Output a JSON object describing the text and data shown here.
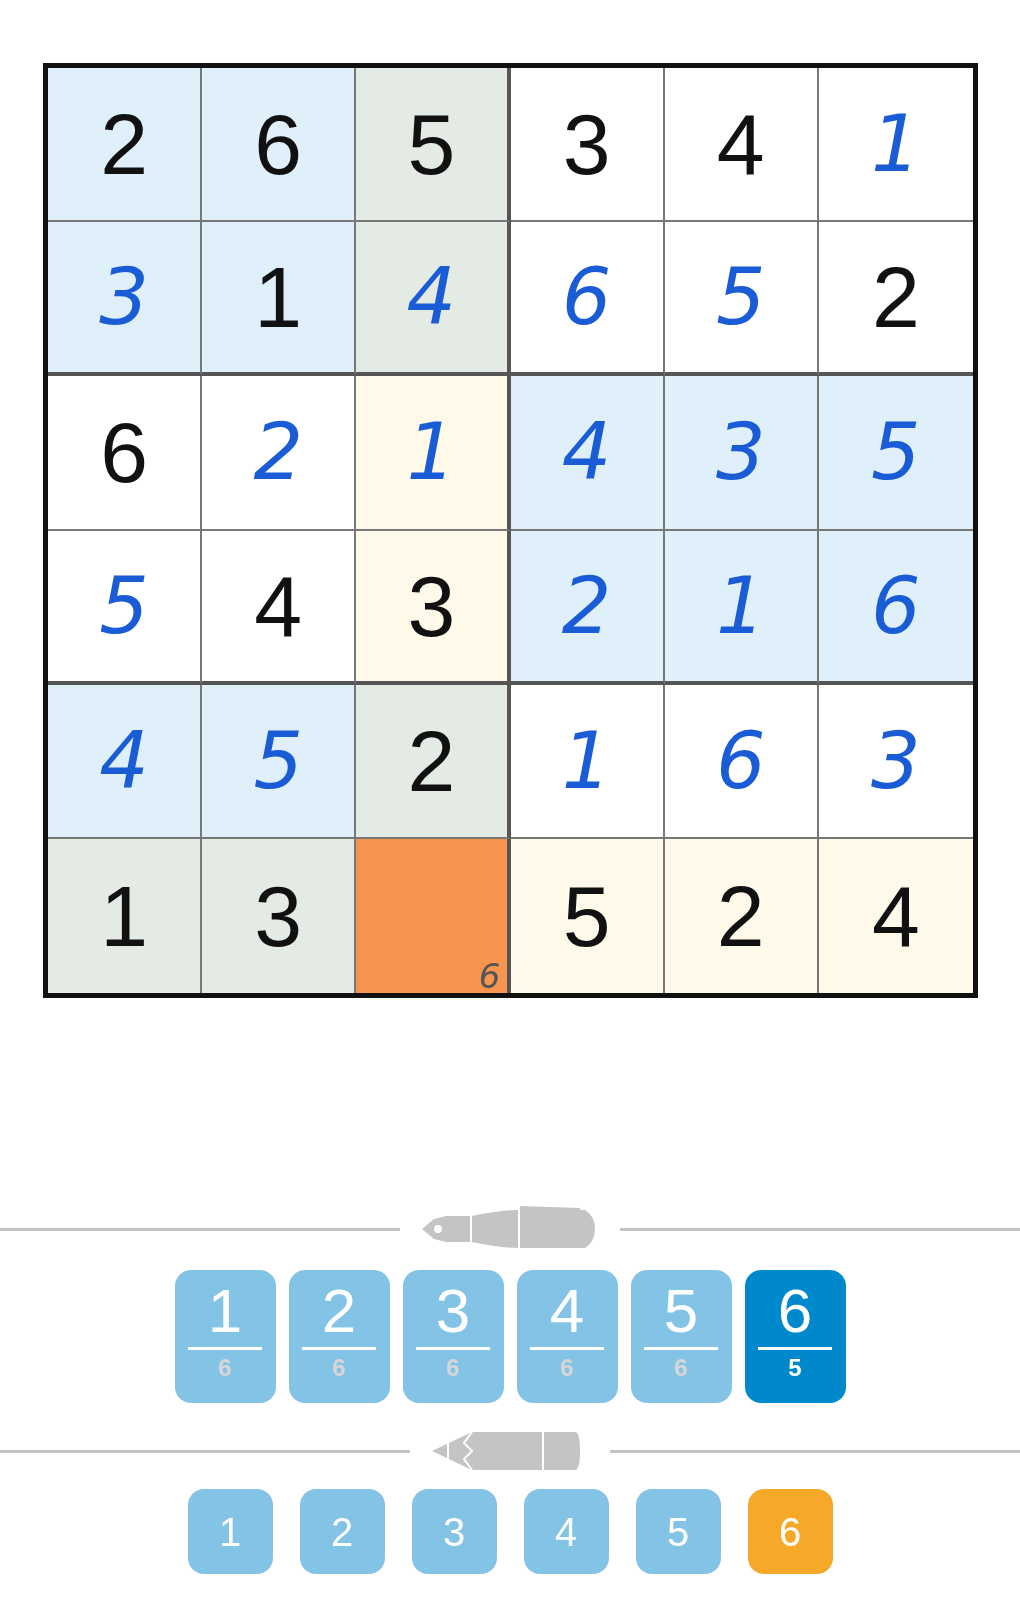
{
  "grid": {
    "rows": [
      [
        {
          "value": "2",
          "kind": "given",
          "color": "#dff0fb",
          "selected": false
        },
        {
          "value": "6",
          "kind": "given",
          "color": "#dff0fb",
          "selected": false
        },
        {
          "value": "5",
          "kind": "given",
          "color": "#e4eae4",
          "selected": false
        },
        {
          "value": "3",
          "kind": "given",
          "color": "#ffffff",
          "selected": false
        },
        {
          "value": "4",
          "kind": "given",
          "color": "#ffffff",
          "selected": false
        },
        {
          "value": "1",
          "kind": "entered",
          "color": "#ffffff",
          "selected": false
        }
      ],
      [
        {
          "value": "3",
          "kind": "entered",
          "color": "#dff0fb",
          "selected": false
        },
        {
          "value": "1",
          "kind": "given",
          "color": "#dff0fb",
          "selected": false
        },
        {
          "value": "4",
          "kind": "entered",
          "color": "#e4eae4",
          "selected": false
        },
        {
          "value": "6",
          "kind": "entered",
          "color": "#ffffff",
          "selected": false
        },
        {
          "value": "5",
          "kind": "entered",
          "color": "#ffffff",
          "selected": false
        },
        {
          "value": "2",
          "kind": "given",
          "color": "#ffffff",
          "selected": false
        }
      ],
      [
        {
          "value": "6",
          "kind": "given",
          "color": "#ffffff",
          "selected": false
        },
        {
          "value": "2",
          "kind": "entered",
          "color": "#ffffff",
          "selected": false
        },
        {
          "value": "1",
          "kind": "entered",
          "color": "#fef9e8",
          "selected": false
        },
        {
          "value": "4",
          "kind": "entered",
          "color": "#dff0fb",
          "selected": false
        },
        {
          "value": "3",
          "kind": "entered",
          "color": "#dff0fb",
          "selected": false
        },
        {
          "value": "5",
          "kind": "entered",
          "color": "#dff0fb",
          "selected": false
        }
      ],
      [
        {
          "value": "5",
          "kind": "entered",
          "color": "#ffffff",
          "selected": false
        },
        {
          "value": "4",
          "kind": "given",
          "color": "#ffffff",
          "selected": false
        },
        {
          "value": "3",
          "kind": "given",
          "color": "#fef9e8",
          "selected": false
        },
        {
          "value": "2",
          "kind": "entered",
          "color": "#dff0fb",
          "selected": false
        },
        {
          "value": "1",
          "kind": "entered",
          "color": "#dff0fb",
          "selected": false
        },
        {
          "value": "6",
          "kind": "entered",
          "color": "#dff0fb",
          "selected": false
        }
      ],
      [
        {
          "value": "4",
          "kind": "entered",
          "color": "#dff0fb",
          "selected": false
        },
        {
          "value": "5",
          "kind": "entered",
          "color": "#dff0fb",
          "selected": false
        },
        {
          "value": "2",
          "kind": "given",
          "color": "#e4eae4",
          "selected": false
        },
        {
          "value": "1",
          "kind": "entered",
          "color": "#ffffff",
          "selected": false
        },
        {
          "value": "6",
          "kind": "entered",
          "color": "#ffffff",
          "selected": false
        },
        {
          "value": "3",
          "kind": "entered",
          "color": "#ffffff",
          "selected": false
        }
      ],
      [
        {
          "value": "1",
          "kind": "given",
          "color": "#e4eae4",
          "selected": false
        },
        {
          "value": "3",
          "kind": "given",
          "color": "#e4eae4",
          "selected": false
        },
        {
          "kind": "empty",
          "notes": [
            "6"
          ],
          "selected": true
        },
        {
          "value": "5",
          "kind": "given",
          "color": "#fef9e8",
          "selected": false
        },
        {
          "value": "2",
          "kind": "given",
          "color": "#fef9e8",
          "selected": false
        },
        {
          "value": "4",
          "kind": "given",
          "color": "#fef9e8",
          "selected": false
        }
      ]
    ]
  },
  "pen_buttons": [
    {
      "digit": "1",
      "count": "6",
      "selected": false
    },
    {
      "digit": "2",
      "count": "6",
      "selected": false
    },
    {
      "digit": "3",
      "count": "6",
      "selected": false
    },
    {
      "digit": "4",
      "count": "6",
      "selected": false
    },
    {
      "digit": "5",
      "count": "6",
      "selected": false
    },
    {
      "digit": "6",
      "count": "5",
      "selected": true
    }
  ],
  "pencil_buttons": [
    {
      "digit": "1",
      "selected": false
    },
    {
      "digit": "2",
      "selected": false
    },
    {
      "digit": "3",
      "selected": false
    },
    {
      "digit": "4",
      "selected": false
    },
    {
      "digit": "5",
      "selected": false
    },
    {
      "digit": "6",
      "selected": true
    }
  ]
}
